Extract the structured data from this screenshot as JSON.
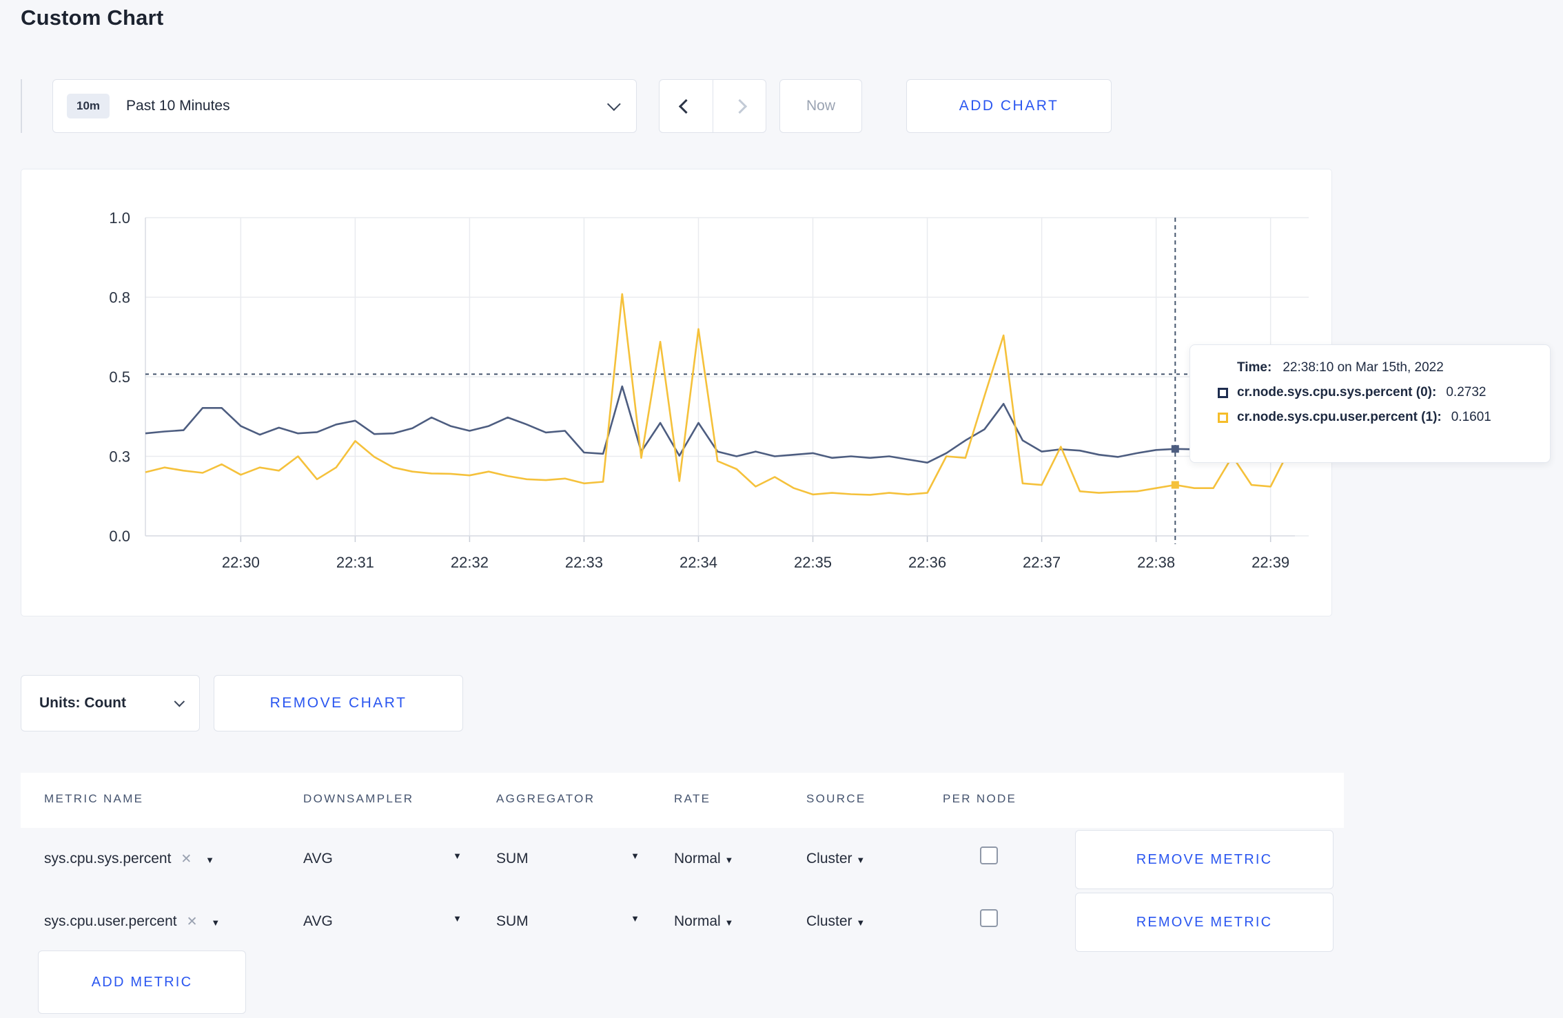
{
  "page": {
    "title": "Custom Chart",
    "background": "#f6f7fa",
    "accent_blue": "#2a56f0"
  },
  "toolbar": {
    "time_window": {
      "badge": "10m",
      "label": "Past 10 Minutes"
    },
    "now_label": "Now",
    "add_chart_label": "ADD CHART"
  },
  "chart_data": {
    "type": "line",
    "title": "",
    "xlabel": "",
    "ylabel": "",
    "ylim": [
      0,
      1
    ],
    "grid": true,
    "x_start_time": "22:29:10",
    "x_interval_seconds": 10,
    "y_ticks": [
      {
        "value": 0.0,
        "label": "0.0"
      },
      {
        "value": 0.25,
        "label": "0.3"
      },
      {
        "value": 0.5,
        "label": "0.5"
      },
      {
        "value": 0.75,
        "label": "0.8"
      },
      {
        "value": 1.0,
        "label": "1.0"
      }
    ],
    "x_tick_labels": [
      "22:30",
      "22:31",
      "22:32",
      "22:33",
      "22:34",
      "22:35",
      "22:36",
      "22:37",
      "22:38",
      "22:39"
    ],
    "series": [
      {
        "name": "cr.node.sys.cpu.sys.percent",
        "color": "#4d5d80",
        "swatch_color": "#1e2d4f",
        "values": [
          0.322,
          0.328,
          0.332,
          0.402,
          0.402,
          0.345,
          0.318,
          0.34,
          0.322,
          0.326,
          0.35,
          0.362,
          0.32,
          0.322,
          0.338,
          0.372,
          0.345,
          0.33,
          0.345,
          0.372,
          0.35,
          0.325,
          0.33,
          0.262,
          0.258,
          0.47,
          0.265,
          0.355,
          0.252,
          0.355,
          0.265,
          0.25,
          0.265,
          0.25,
          0.255,
          0.26,
          0.245,
          0.25,
          0.245,
          0.25,
          0.24,
          0.23,
          0.26,
          0.3,
          0.335,
          0.415,
          0.3,
          0.265,
          0.272,
          0.268,
          0.255,
          0.248,
          0.26,
          0.27,
          0.2732,
          0.272,
          0.282,
          0.245,
          0.243,
          0.247,
          0.247,
          0.3
        ]
      },
      {
        "name": "cr.node.sys.cpu.user.percent",
        "color": "#f5c13b",
        "swatch_color": "#f5bd2a",
        "values": [
          0.2,
          0.215,
          0.205,
          0.198,
          0.225,
          0.192,
          0.215,
          0.205,
          0.25,
          0.178,
          0.215,
          0.298,
          0.248,
          0.215,
          0.202,
          0.196,
          0.195,
          0.19,
          0.202,
          0.188,
          0.178,
          0.175,
          0.18,
          0.165,
          0.17,
          0.76,
          0.245,
          0.61,
          0.172,
          0.65,
          0.235,
          0.21,
          0.155,
          0.185,
          0.15,
          0.13,
          0.135,
          0.131,
          0.129,
          0.135,
          0.13,
          0.135,
          0.25,
          0.245,
          0.44,
          0.63,
          0.165,
          0.16,
          0.28,
          0.14,
          0.135,
          0.138,
          0.14,
          0.15,
          0.1601,
          0.15,
          0.15,
          0.25,
          0.16,
          0.155,
          0.272,
          0.24
        ]
      }
    ],
    "hover": {
      "time": "22:38:10",
      "crosshair_y_value": 0.508,
      "tooltip": {
        "time_label": "Time:",
        "time_value": "22:38:10 on Mar 15th, 2022",
        "entries": [
          {
            "name": "cr.node.sys.cpu.sys.percent (0):",
            "value": "0.2732",
            "swatch_color": "#1e2d4f"
          },
          {
            "name": "cr.node.sys.cpu.user.percent (1):",
            "value": "0.1601",
            "swatch_color": "#f5bd2a"
          }
        ]
      }
    }
  },
  "units_row": {
    "units_label": "Units: Count",
    "remove_chart_label": "REMOVE CHART"
  },
  "metrics_table": {
    "headers": [
      "METRIC NAME",
      "DOWNSAMPLER",
      "AGGREGATOR",
      "RATE",
      "SOURCE",
      "PER NODE"
    ],
    "rows": [
      {
        "metric": "sys.cpu.sys.percent",
        "downsampler": "AVG",
        "aggregator": "SUM",
        "rate": "Normal",
        "source": "Cluster",
        "per_node_checked": false,
        "remove_label": "REMOVE METRIC"
      },
      {
        "metric": "sys.cpu.user.percent",
        "downsampler": "AVG",
        "aggregator": "SUM",
        "rate": "Normal",
        "source": "Cluster",
        "per_node_checked": false,
        "remove_label": "REMOVE METRIC"
      }
    ],
    "add_metric_label": "ADD METRIC"
  }
}
